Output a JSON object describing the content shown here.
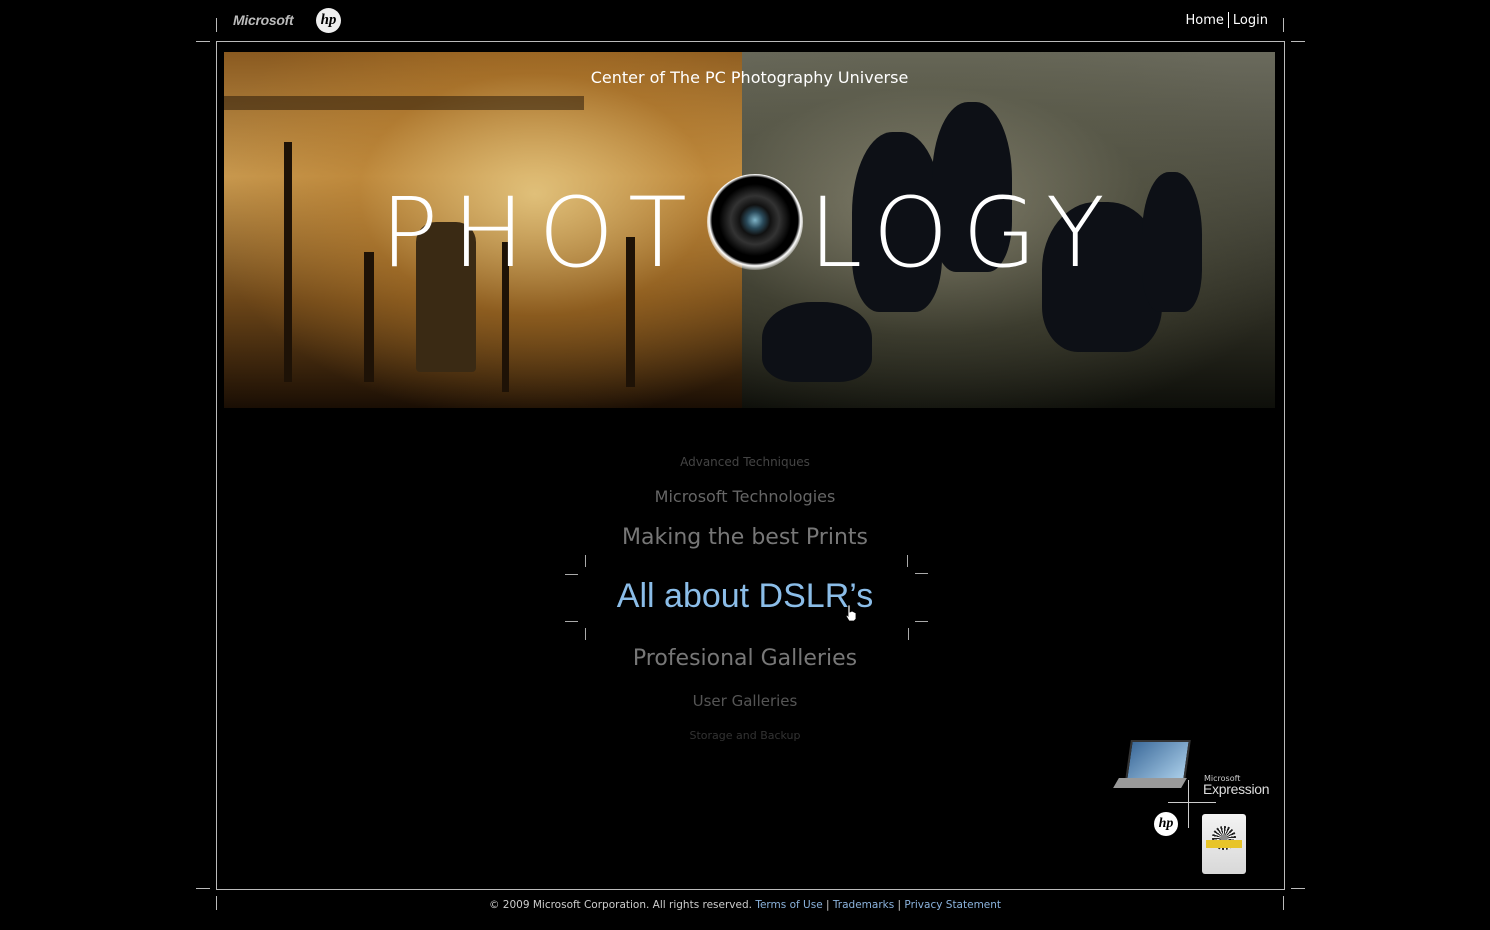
{
  "header": {
    "microsoft_logo": "Microsoft",
    "hp_logo": "hp",
    "nav": {
      "home": "Home",
      "login": "Login"
    }
  },
  "hero": {
    "tagline": "Center of The PC Photography Universe",
    "title_left": "PHOT",
    "title_right": "LOGY"
  },
  "menu": {
    "items": [
      "Advanced Techniques",
      "Microsoft Technologies",
      "Making the best Prints",
      "All about DSLR’s",
      "Profesional Galleries",
      "User Galleries",
      "Storage and Backup"
    ],
    "selected": "All about DSLR’s"
  },
  "partners": {
    "microsoft_small": "Microsoft",
    "expression": "Expression",
    "hp": "hp"
  },
  "footer": {
    "copyright": "© 2009 Microsoft Corporation. All rights reserved.",
    "links": [
      "Terms of Use",
      "Trademarks",
      "Privacy Statement"
    ],
    "separator": "|"
  },
  "colors": {
    "selected": "#8bbde8",
    "footer_link": "#8bb3dd",
    "background": "#000000"
  },
  "icons": {
    "cursor": "hand-cursor-icon",
    "lens": "camera-lens-icon"
  }
}
